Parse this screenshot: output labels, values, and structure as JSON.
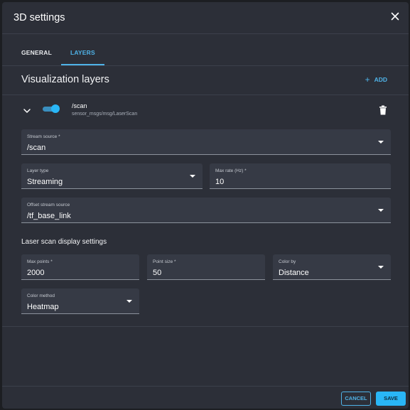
{
  "dialog": {
    "title": "3D settings"
  },
  "tabs": [
    {
      "label": "GENERAL",
      "active": false
    },
    {
      "label": "LAYERS",
      "active": true
    }
  ],
  "layers_section": {
    "title": "Visualization layers",
    "add_label": "ADD"
  },
  "layer": {
    "name": "/scan",
    "type": "sensor_msgs/msg/LaserScan",
    "enabled": true,
    "expanded": true
  },
  "fields": {
    "stream_source": {
      "label": "Stream source *",
      "value": "/scan"
    },
    "layer_type": {
      "label": "Layer type",
      "value": "Streaming"
    },
    "max_rate": {
      "label": "Max rate (Hz) *",
      "value": "10"
    },
    "offset_stream_source": {
      "label": "Offset stream source",
      "value": "/tf_base_link"
    }
  },
  "laser_settings": {
    "title": "Laser scan display settings",
    "max_points": {
      "label": "Max points *",
      "value": "2000"
    },
    "point_size": {
      "label": "Point size *",
      "value": "50"
    },
    "color_by": {
      "label": "Color by",
      "value": "Distance"
    },
    "color_method": {
      "label": "Color method",
      "value": "Heatmap"
    }
  },
  "footer": {
    "cancel_label": "CANCEL",
    "save_label": "SAVE"
  },
  "colors": {
    "accent": "#4fb3e8",
    "primary_button": "#29b6f6",
    "background": "#2c2f38",
    "field_background": "#363a45"
  },
  "icons": {
    "close": "close-icon",
    "add": "plus-icon",
    "expand": "chevron-down-icon",
    "toggle": "toggle-switch",
    "delete": "trash-icon",
    "dropdown": "caret-down-icon"
  }
}
